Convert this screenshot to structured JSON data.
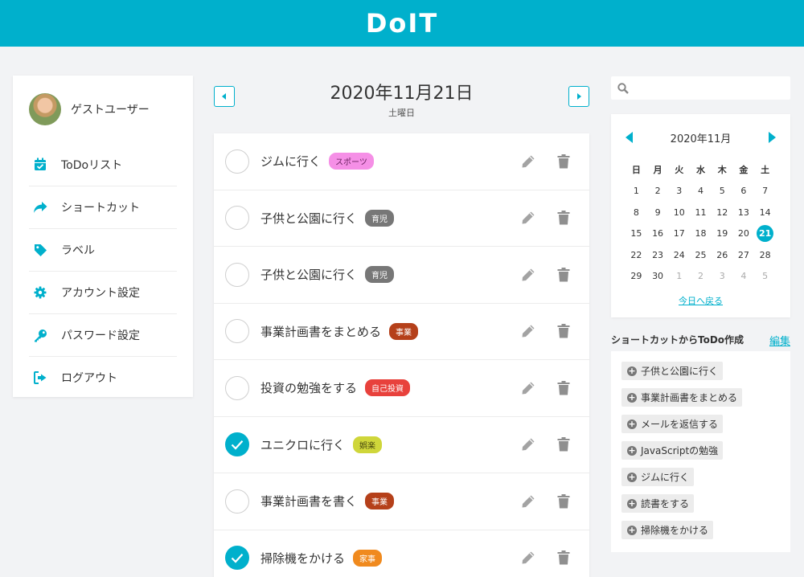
{
  "app": {
    "logo": "DoIT",
    "accent": "#00b0cc"
  },
  "sidebar": {
    "user_name": "ゲストユーザー",
    "items": [
      {
        "label": "ToDoリスト",
        "icon": "calendar-check-icon"
      },
      {
        "label": "ショートカット",
        "icon": "share-arrow-icon"
      },
      {
        "label": "ラベル",
        "icon": "tag-icon"
      },
      {
        "label": "アカウント設定",
        "icon": "gear-icon"
      },
      {
        "label": "パスワード設定",
        "icon": "key-icon"
      },
      {
        "label": "ログアウト",
        "icon": "sign-out-icon"
      }
    ]
  },
  "date_header": {
    "title": "2020年11月21日",
    "weekday": "土曜日"
  },
  "todos": [
    {
      "text": "ジムに行く",
      "tag": "スポーツ",
      "tag_bg": "#f58fe6",
      "tag_fg": "#6b2160",
      "done": false
    },
    {
      "text": "子供と公園に行く",
      "tag": "育児",
      "tag_bg": "#777777",
      "tag_fg": "#ffffff",
      "done": false
    },
    {
      "text": "子供と公園に行く",
      "tag": "育児",
      "tag_bg": "#777777",
      "tag_fg": "#ffffff",
      "done": false
    },
    {
      "text": "事業計画書をまとめる",
      "tag": "事業",
      "tag_bg": "#b5401a",
      "tag_fg": "#ffffff",
      "done": false
    },
    {
      "text": "投資の勉強をする",
      "tag": "自己投資",
      "tag_bg": "#e8413c",
      "tag_fg": "#ffffff",
      "done": false
    },
    {
      "text": "ユニクロに行く",
      "tag": "娯楽",
      "tag_bg": "#cfd63a",
      "tag_fg": "#4a4a10",
      "done": true
    },
    {
      "text": "事業計画書を書く",
      "tag": "事業",
      "tag_bg": "#b5401a",
      "tag_fg": "#ffffff",
      "done": false
    },
    {
      "text": "掃除機をかける",
      "tag": "家事",
      "tag_bg": "#f08a1e",
      "tag_fg": "#ffffff",
      "done": true
    }
  ],
  "search": {
    "placeholder": ""
  },
  "calendar": {
    "title": "2020年11月",
    "weekdays": [
      "日",
      "月",
      "火",
      "水",
      "木",
      "金",
      "土"
    ],
    "days": [
      [
        1,
        2,
        3,
        4,
        5,
        6,
        7
      ],
      [
        8,
        9,
        10,
        11,
        12,
        13,
        14
      ],
      [
        15,
        16,
        17,
        18,
        19,
        20,
        21
      ],
      [
        22,
        23,
        24,
        25,
        26,
        27,
        28
      ],
      [
        29,
        30,
        1,
        2,
        3,
        4,
        5
      ]
    ],
    "selected_day": 21,
    "today_link": "今日へ戻る"
  },
  "shortcuts": {
    "title": "ショートカットからToDo作成",
    "edit_label": "編集",
    "items": [
      "子供と公園に行く",
      "事業計画書をまとめる",
      "メールを返信する",
      "JavaScriptの勉強",
      "ジムに行く",
      "読書をする",
      "掃除機をかける"
    ]
  }
}
